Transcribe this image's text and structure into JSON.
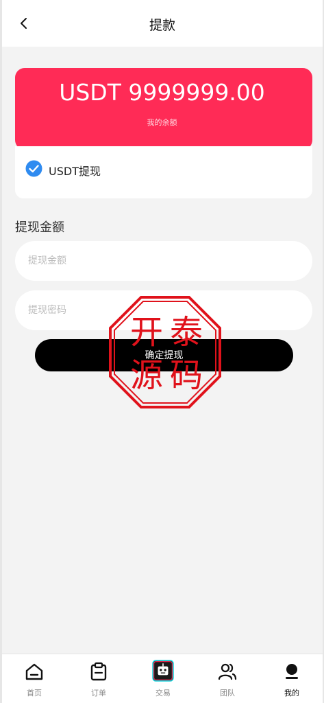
{
  "header": {
    "title": "提款",
    "back_icon": "chevron-left-icon"
  },
  "balance": {
    "amount": "USDT 9999999.00",
    "label": "我的余额",
    "card_color": "#ff2b56"
  },
  "method": {
    "label": "USDT提现",
    "checked": true,
    "check_color": "#2f8bf0"
  },
  "form": {
    "section_title": "提现金额",
    "amount_placeholder": "提现金额",
    "password_placeholder": "提现密码",
    "submit_label": "确定提现"
  },
  "watermark": {
    "text": "开泰源码",
    "color": "#e0121b"
  },
  "tabbar": {
    "items": [
      {
        "label": "首页",
        "icon": "home-icon",
        "active": false
      },
      {
        "label": "订单",
        "icon": "clipboard-icon",
        "active": false
      },
      {
        "label": "交易",
        "icon": "robot-icon",
        "active": false
      },
      {
        "label": "团队",
        "icon": "team-icon",
        "active": false
      },
      {
        "label": "我的",
        "icon": "user-icon",
        "active": true
      }
    ]
  }
}
